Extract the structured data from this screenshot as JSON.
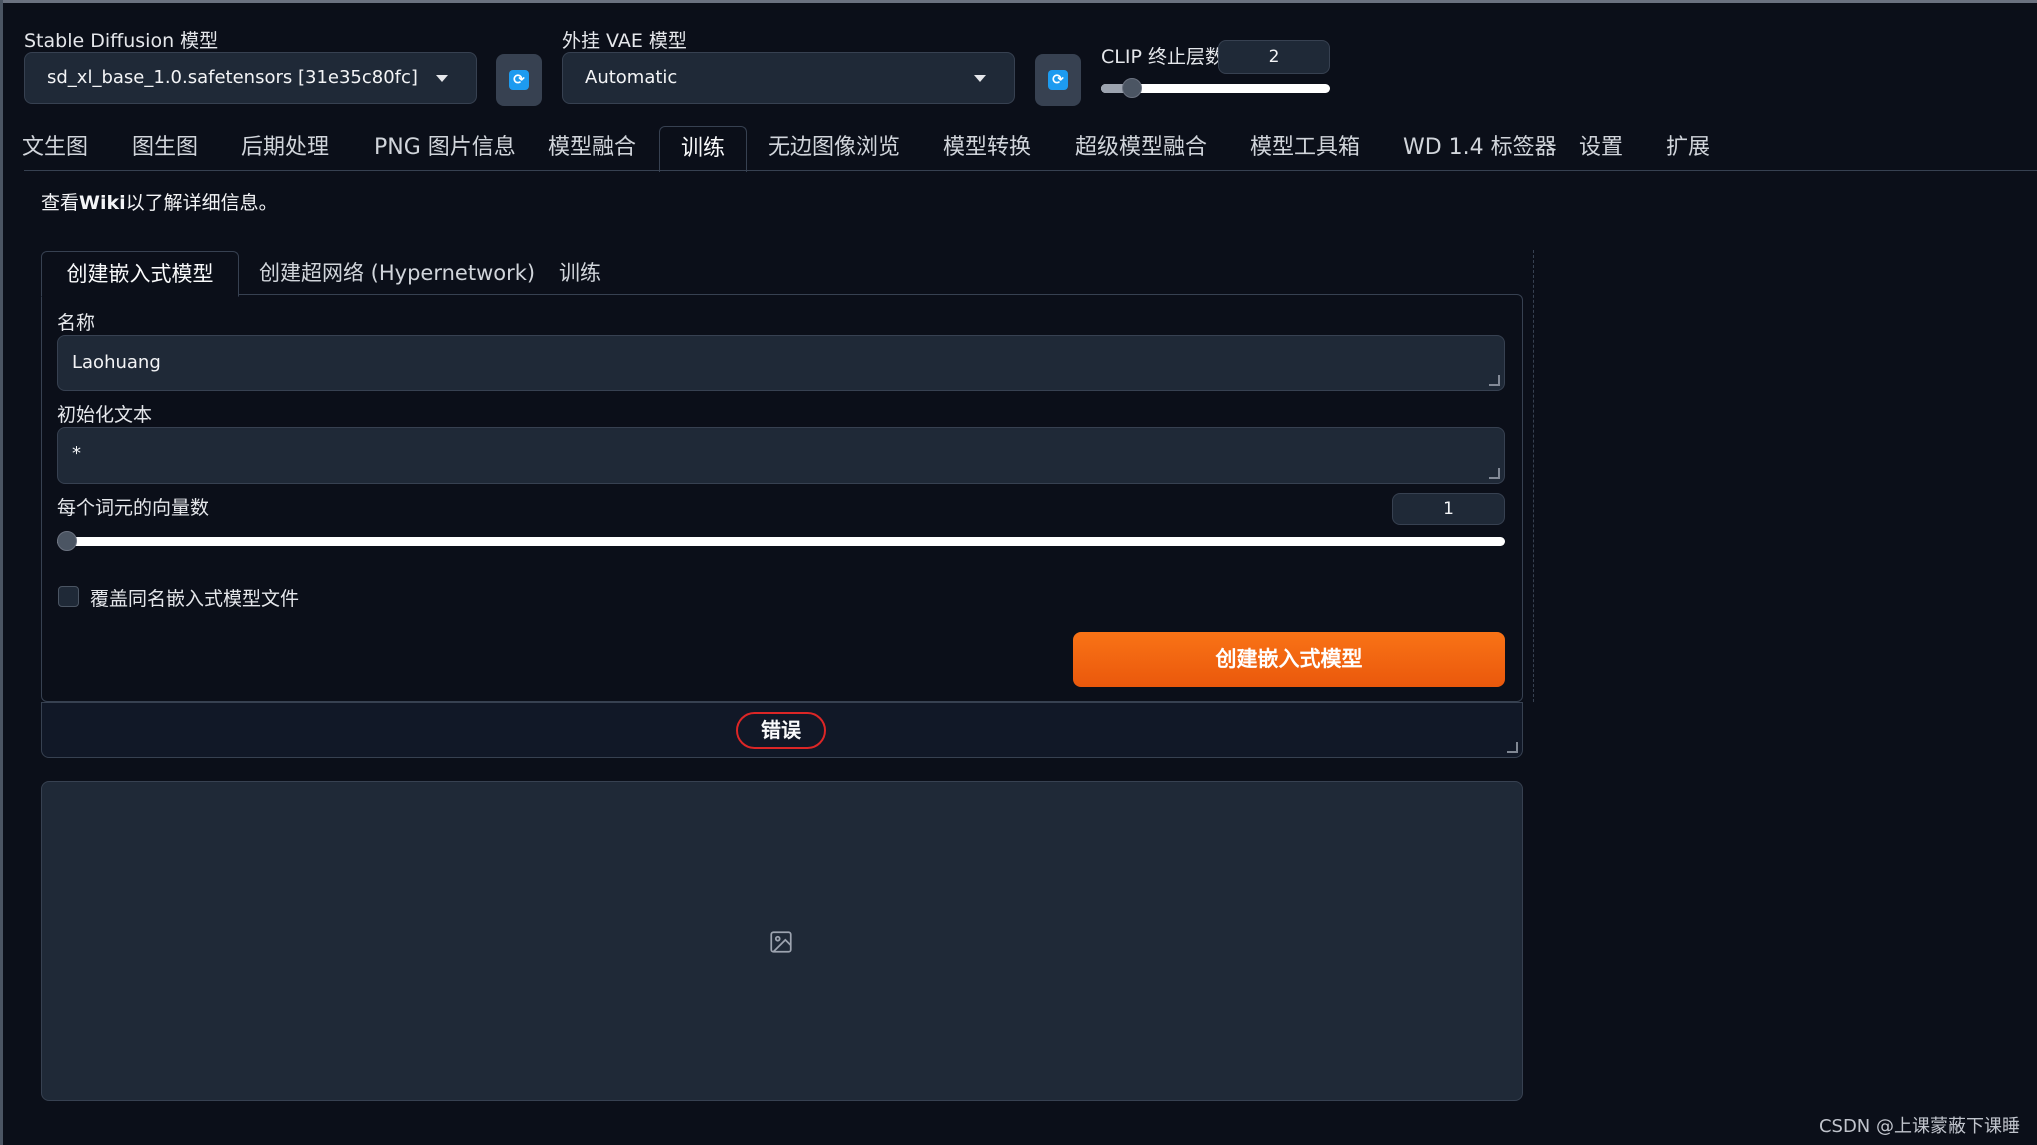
{
  "header": {
    "sd_model_label": "Stable Diffusion 模型",
    "sd_model_value": "sd_xl_base_1.0.safetensors [31e35c80fc]",
    "vae_label": "外挂 VAE 模型",
    "vae_value": "Automatic",
    "clip_label": "CLIP 终止层数",
    "clip_value": "2",
    "clip_slider_fraction": 0.1
  },
  "tabs": [
    {
      "label": "文生图"
    },
    {
      "label": "图生图"
    },
    {
      "label": "后期处理"
    },
    {
      "label": "PNG 图片信息"
    },
    {
      "label": "模型融合"
    },
    {
      "label": "训练"
    },
    {
      "label": "无边图像浏览"
    },
    {
      "label": "模型转换"
    },
    {
      "label": "超级模型融合"
    },
    {
      "label": "模型工具箱"
    },
    {
      "label": "WD 1.4 标签器"
    },
    {
      "label": "设置"
    },
    {
      "label": "扩展"
    }
  ],
  "active_tab": "训练",
  "wiki": {
    "prefix": "查看",
    "link": "Wiki",
    "suffix": "以了解详细信息。"
  },
  "subtabs": [
    {
      "label": "创建嵌入式模型"
    },
    {
      "label": "创建超网络 (Hypernetwork)"
    },
    {
      "label": "训练"
    }
  ],
  "form": {
    "name_label": "名称",
    "name_value": "Laohuang",
    "init_text_label": "初始化文本",
    "init_text_value": "*",
    "vectors_label": "每个词元的向量数",
    "vectors_value": "1",
    "vectors_slider_fraction": 0.0,
    "overwrite_label": "覆盖同名嵌入式模型文件",
    "overwrite_checked": false,
    "create_button": "创建嵌入式模型"
  },
  "status": {
    "badge": "错误",
    "badge_color": "#dc2626"
  },
  "output": {
    "icon": "image-placeholder-icon"
  },
  "watermark": "CSDN @上课蒙蔽下课睡",
  "colors": {
    "accent": "#f97316",
    "background": "#0b0f19",
    "field": "#1f2937"
  }
}
